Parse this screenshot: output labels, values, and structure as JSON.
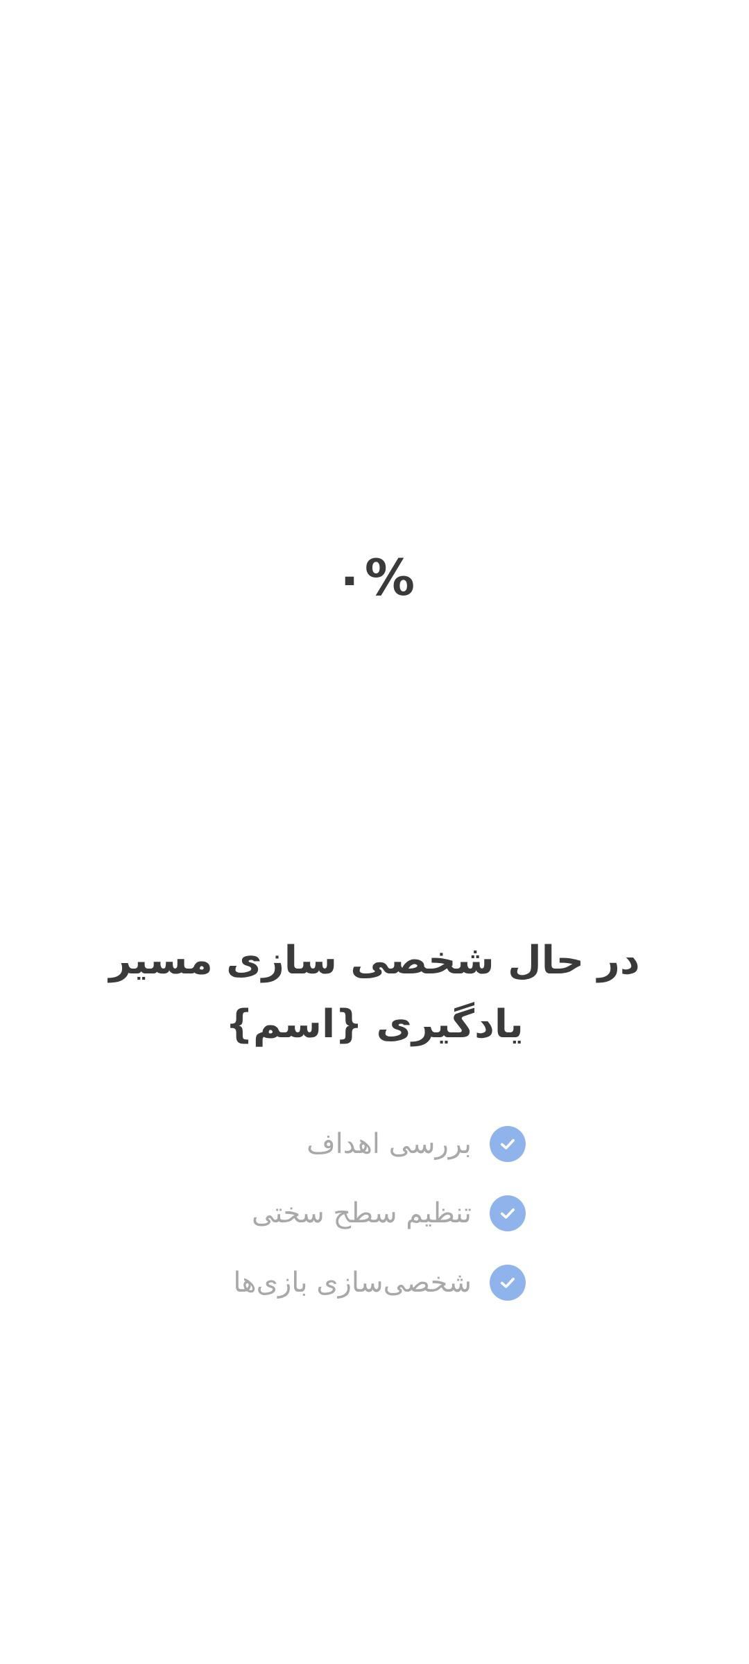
{
  "progress": {
    "percent_text": "۰%",
    "value": 0
  },
  "title": "در حال شخصی سازی مسیر یادگیری {اسم}",
  "steps": [
    {
      "label": "بررسی اهداف",
      "status": "done",
      "icon": "check-circle-icon"
    },
    {
      "label": "تنظیم سطح سختی",
      "status": "done",
      "icon": "check-circle-icon"
    },
    {
      "label": "شخصی‌سازی بازی‌ها",
      "status": "done",
      "icon": "check-circle-icon"
    }
  ],
  "colors": {
    "background": "#ffffff",
    "text_primary": "#3a3a3a",
    "text_secondary": "#a8a8a8",
    "check_fill": "#8fb4ec"
  }
}
